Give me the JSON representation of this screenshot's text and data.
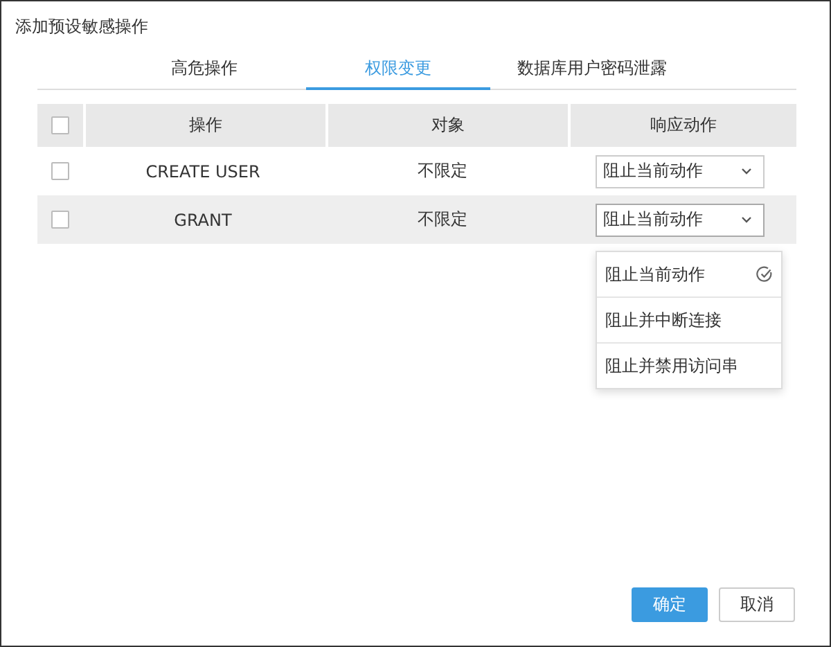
{
  "dialog": {
    "title": "添加预设敏感操作"
  },
  "tabs": [
    {
      "label": "高危操作",
      "selected": false
    },
    {
      "label": "权限变更",
      "selected": true
    },
    {
      "label": "数据库用户密码泄露",
      "selected": false
    }
  ],
  "table": {
    "header_checked": false,
    "columns": [
      "操作",
      "对象",
      "响应动作"
    ],
    "rows": [
      {
        "checked": false,
        "operation": "CREATE USER",
        "object": "不限定",
        "action": "阻止当前动作",
        "expanded": false
      },
      {
        "checked": false,
        "operation": "GRANT",
        "object": "不限定",
        "action": "阻止当前动作",
        "expanded": true
      }
    ]
  },
  "dropdown_menu": [
    {
      "label": "阻止当前动作",
      "selected": true
    },
    {
      "label": "阻止并中断连接",
      "selected": false
    },
    {
      "label": "阻止并禁用访问串",
      "selected": false
    }
  ],
  "buttons": [
    {
      "label": "确定",
      "kind": "primary"
    },
    {
      "label": "取消",
      "kind": "secondary"
    }
  ]
}
